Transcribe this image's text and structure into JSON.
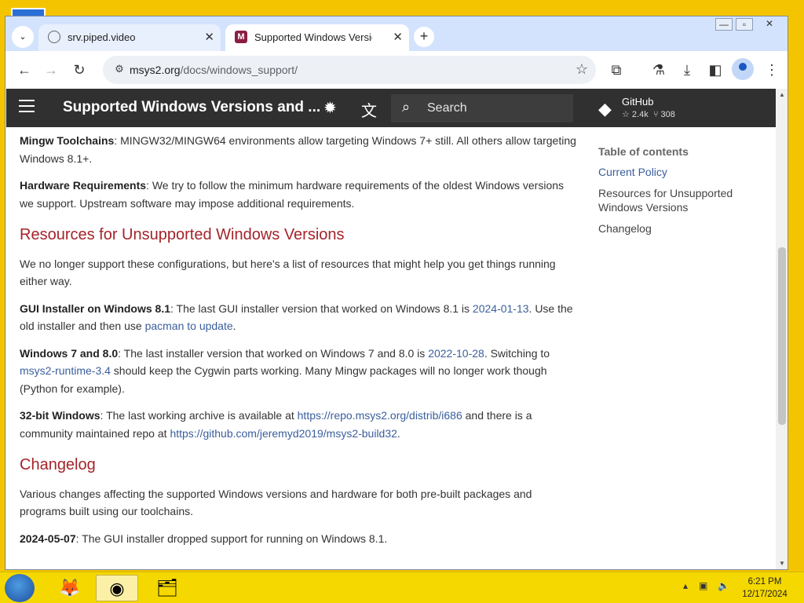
{
  "browser": {
    "tabs": [
      {
        "label": "srv.piped.video",
        "close": "✕"
      },
      {
        "label": "Supported Windows Versions",
        "close": "✕",
        "favicon": "M"
      }
    ],
    "new_tab": "+",
    "window_controls": {
      "minimize": "—",
      "maximize": "▫",
      "close": "✕"
    },
    "url_host": "msys2.org",
    "url_path": "/docs/windows_support/"
  },
  "site_header": {
    "title": "Supported Windows Versions and ...",
    "search_placeholder": "Search",
    "github": {
      "name": "GitHub",
      "stars": "2.4k",
      "forks": "308"
    }
  },
  "article": {
    "mingw_label": "Mingw Toolchains",
    "mingw_text": ": MINGW32/MINGW64 environments allow targeting Windows 7+ still. All others allow targeting Windows 8.1+.",
    "hw_label": "Hardware Requirements",
    "hw_text": ": We try to follow the minimum hardware requirements of the oldest Windows versions we support. Upstream software may impose additional requirements.",
    "h_unsupported": "Resources for Unsupported Windows Versions",
    "unsupported_intro": "We no longer support these configurations, but here's a list of resources that might help you get things running either way.",
    "gui_label": "GUI Installer on Windows 8.1",
    "gui_text1": ": The last GUI installer version that worked on Windows 8.1 is ",
    "gui_link1": "2024-01-13",
    "gui_text2": ". Use the old installer and then use ",
    "gui_link2": "pacman to update",
    "gui_text3": ".",
    "w7_label": "Windows 7 and 8.0",
    "w7_text1": ": The last installer version that worked on Windows 7 and 8.0 is ",
    "w7_link1": "2022-10-28",
    "w7_text2": ". Switching to ",
    "w7_link2": "msys2-runtime-3.4",
    "w7_text3": " should keep the Cygwin parts working. Many Mingw packages will no longer work though (Python for example).",
    "b32_label": "32-bit Windows",
    "b32_text1": ": The last working archive is available at ",
    "b32_link1": "https://repo.msys2.org/distrib/i686",
    "b32_text2": " and there is a community maintained repo at ",
    "b32_link2": "https://github.com/jeremyd2019/msys2-build32",
    "b32_text3": ".",
    "h_changelog": "Changelog",
    "changelog_intro": "Various changes affecting the supported Windows versions and hardware for both pre-built packages and programs built using our toolchains.",
    "cl_date": "2024-05-07",
    "cl_text": ": The GUI installer dropped support for running on Windows 8.1."
  },
  "toc": {
    "heading": "Table of contents",
    "items": [
      "Current Policy",
      "Resources for Unsupported Windows Versions",
      "Changelog"
    ]
  },
  "taskbar": {
    "time": "6:21 PM",
    "date": "12/17/2024"
  }
}
